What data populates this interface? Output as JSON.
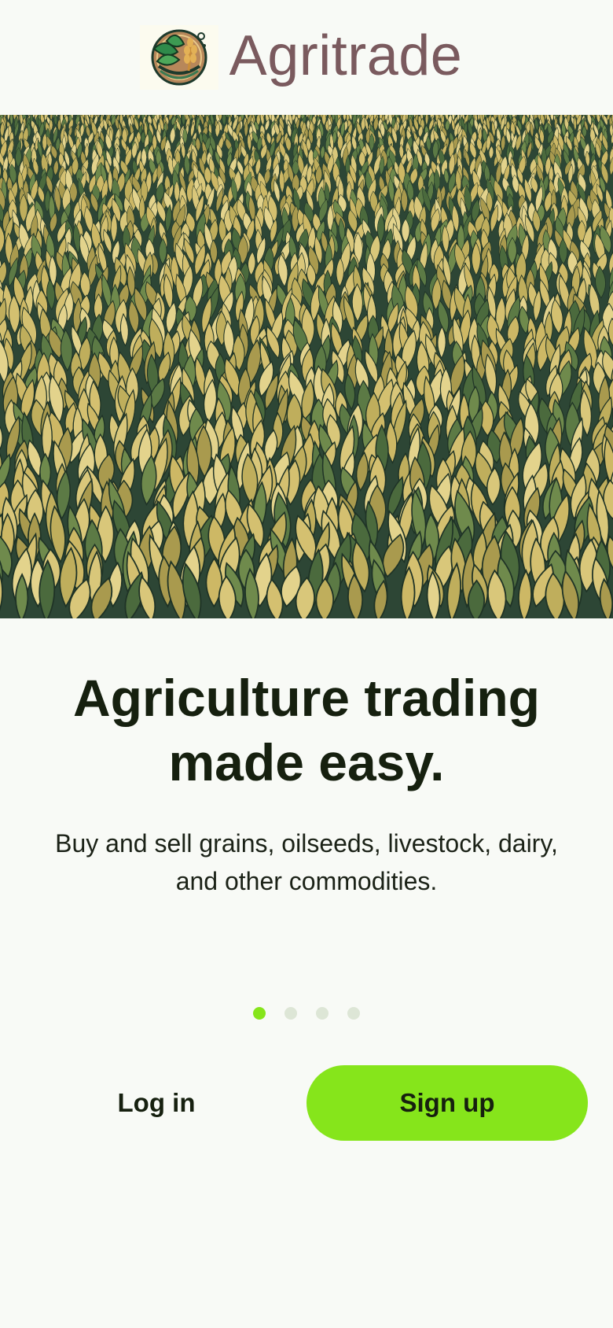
{
  "header": {
    "brand_name": "Agritrade",
    "logo_icon": "wheat-leaf-emblem-icon"
  },
  "hero": {
    "image_icon": "cornfield-photo"
  },
  "main": {
    "headline_line1": "Agriculture trading",
    "headline_line2": "made easy.",
    "subtitle_line1": "Buy and sell grains, oilseeds, livestock, dairy,",
    "subtitle_line2": "and other commodities."
  },
  "pager": {
    "total": 4,
    "active_index": 0
  },
  "actions": {
    "login_label": "Log in",
    "signup_label": "Sign up"
  },
  "colors": {
    "accent": "#86e51b",
    "brand_text": "#7a5a5e",
    "background": "#f8faf6",
    "text": "#16200f"
  }
}
